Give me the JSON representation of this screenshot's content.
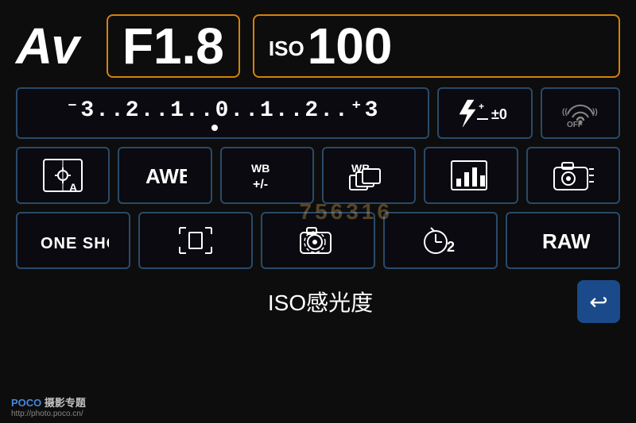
{
  "header": {
    "mode": "Av",
    "aperture": "F1.8",
    "iso_label": "ISO",
    "iso_value": "100"
  },
  "exposure": {
    "scale": "⁻3..2..1..0̲..1..2..⁺3",
    "scale_display": "-3..2..1..0..1..2..+3"
  },
  "flash": {
    "icon": "⚡±0",
    "label": "Flash compensation ±0"
  },
  "wifi": {
    "label": "WiFi OFF"
  },
  "icons": {
    "metering": "☀A",
    "awb": "AWB",
    "wb_adjust": "WB\n+/-",
    "wb_bracket": "WB≤",
    "picture_style": "📊",
    "camera_settings": "📷≡"
  },
  "bottom_row": {
    "one_shot": "ONE SHOT",
    "focus_point": "□",
    "live_view": "⊙",
    "self_timer": "⏱2",
    "raw": "RAW"
  },
  "footer": {
    "iso_label": "ISO感光度",
    "back_icon": "↩",
    "poco_title": "POCO 摄影专题",
    "poco_url": "http://photo.poco.cn/"
  },
  "watermark": "756316"
}
